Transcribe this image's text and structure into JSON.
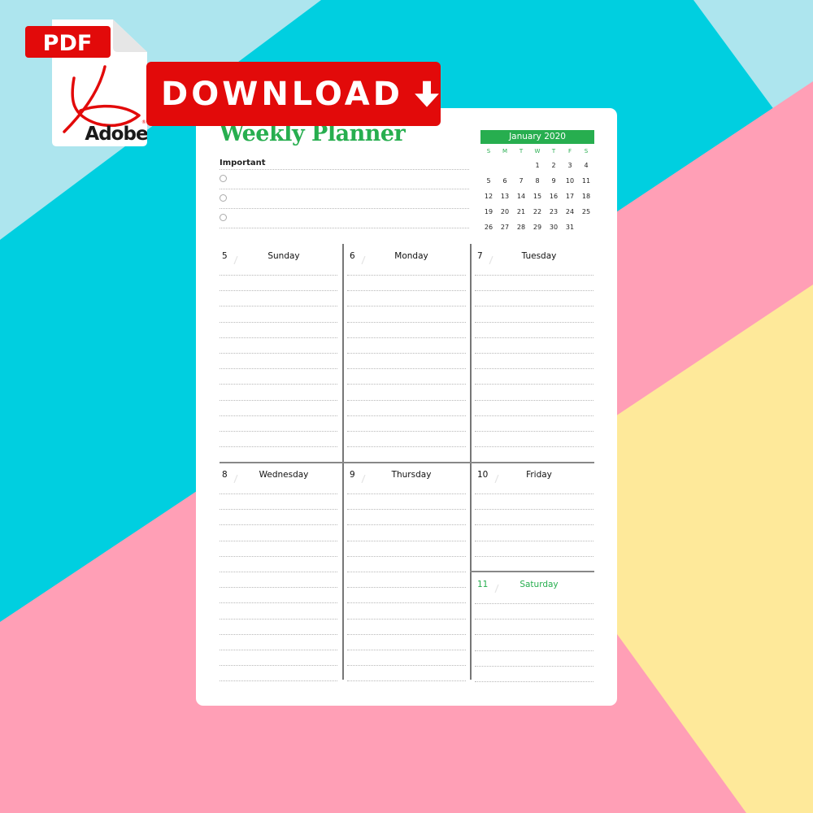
{
  "colors": {
    "accent_green": "#27ae4f",
    "download_red": "#e20a0a",
    "bg_light_blue": "#ade5ee",
    "bg_cyan": "#00cfe0",
    "bg_pink": "#ff9fb6",
    "bg_yellow": "#fee99a"
  },
  "badge": {
    "pdf_label": "PDF",
    "brand_label": "Adobe",
    "icon": "adobe-acrobat-icon",
    "download_label": "DOWNLOAD",
    "download_icon": "arrow-down-icon"
  },
  "planner": {
    "title": "Weekly Planner",
    "important_label": "Important",
    "important_items": 3,
    "calendar": {
      "month": "January 2020",
      "weekdays": [
        "S",
        "M",
        "T",
        "W",
        "T",
        "F",
        "S"
      ],
      "weeks": [
        [
          "",
          "",
          "",
          "1",
          "2",
          "3",
          "4"
        ],
        [
          "5",
          "6",
          "7",
          "8",
          "9",
          "10",
          "11"
        ],
        [
          "12",
          "13",
          "14",
          "15",
          "16",
          "17",
          "18"
        ],
        [
          "19",
          "20",
          "21",
          "22",
          "23",
          "24",
          "25"
        ],
        [
          "26",
          "27",
          "28",
          "29",
          "30",
          "31",
          ""
        ]
      ]
    },
    "days": [
      {
        "num": "5",
        "name": "Sunday"
      },
      {
        "num": "6",
        "name": "Monday"
      },
      {
        "num": "7",
        "name": "Tuesday"
      },
      {
        "num": "8",
        "name": "Wednesday"
      },
      {
        "num": "9",
        "name": "Thursday"
      },
      {
        "num": "10",
        "name": "Friday"
      },
      {
        "num": "11",
        "name": "Saturday"
      }
    ]
  }
}
